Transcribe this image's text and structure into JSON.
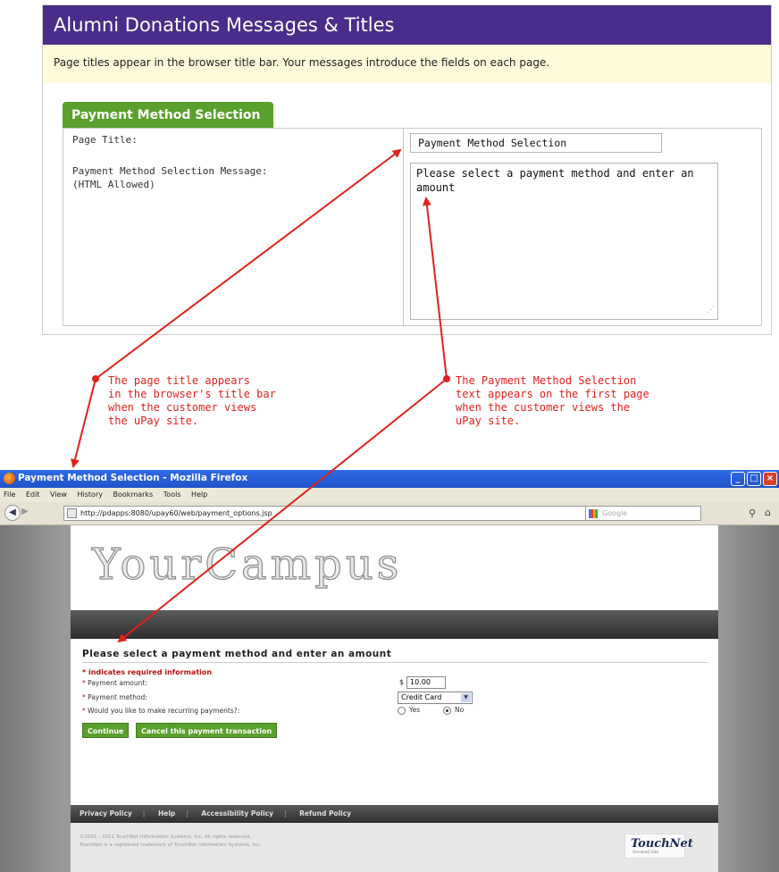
{
  "admin": {
    "header_title": "Alumni Donations Messages & Titles",
    "info_text": "Page titles appear in the browser title bar. Your messages introduce the fields on each page.",
    "section_tab": "Payment Method Selection",
    "page_title_label": "Page Title:",
    "message_label": "Payment Method Selection Message:",
    "message_label_note": "(HTML Allowed)",
    "page_title_value": "Payment Method Selection",
    "message_value": "Please select a payment method and enter an amount"
  },
  "annotations": {
    "left": [
      "The page title appears",
      "in the browser's title bar",
      "when the customer views",
      "the uPay site."
    ],
    "right": [
      "The Payment Method Selection",
      "text appears on the first page",
      "when the customer views the",
      "uPay site."
    ],
    "color": "#e0221b"
  },
  "browser": {
    "window_title": "Payment Method Selection - Mozilla Firefox",
    "menu": [
      "File",
      "Edit",
      "View",
      "History",
      "Bookmarks",
      "Tools",
      "Help"
    ],
    "url": "http://pdapps:8080/upay60/web/payment_options.jsp",
    "search_placeholder": "Google",
    "icons": [
      "firefox-icon",
      "back-icon",
      "forward-icon",
      "page-icon",
      "search-icon",
      "home-icon"
    ]
  },
  "site": {
    "logo_text": "YourCampus",
    "heading": "Please select a payment method and enter an amount",
    "required_note": "* indicates required information",
    "amount_label": "Payment amount:",
    "method_label": "Payment method:",
    "recurring_label": "Would you like to make recurring payments?:",
    "currency": "$",
    "amount_value": "10.00",
    "method_value": "Credit Card",
    "recurring_options": [
      "Yes",
      "No"
    ],
    "recurring_selected": "No",
    "continue_label": "Continue",
    "cancel_label": "Cancel this payment transaction",
    "footer_links": [
      "Privacy Policy",
      "Help",
      "Accessibility Policy",
      "Refund Policy"
    ],
    "copyright_1": "©2001 - 2011 TouchNet Information Systems, Inc. All rights reserved.",
    "copyright_2": "TouchNet is a registered trademark of TouchNet Information Systems, Inc.",
    "touchnet_logo": "TouchNet",
    "touchnet_sub": "Secured Site"
  }
}
